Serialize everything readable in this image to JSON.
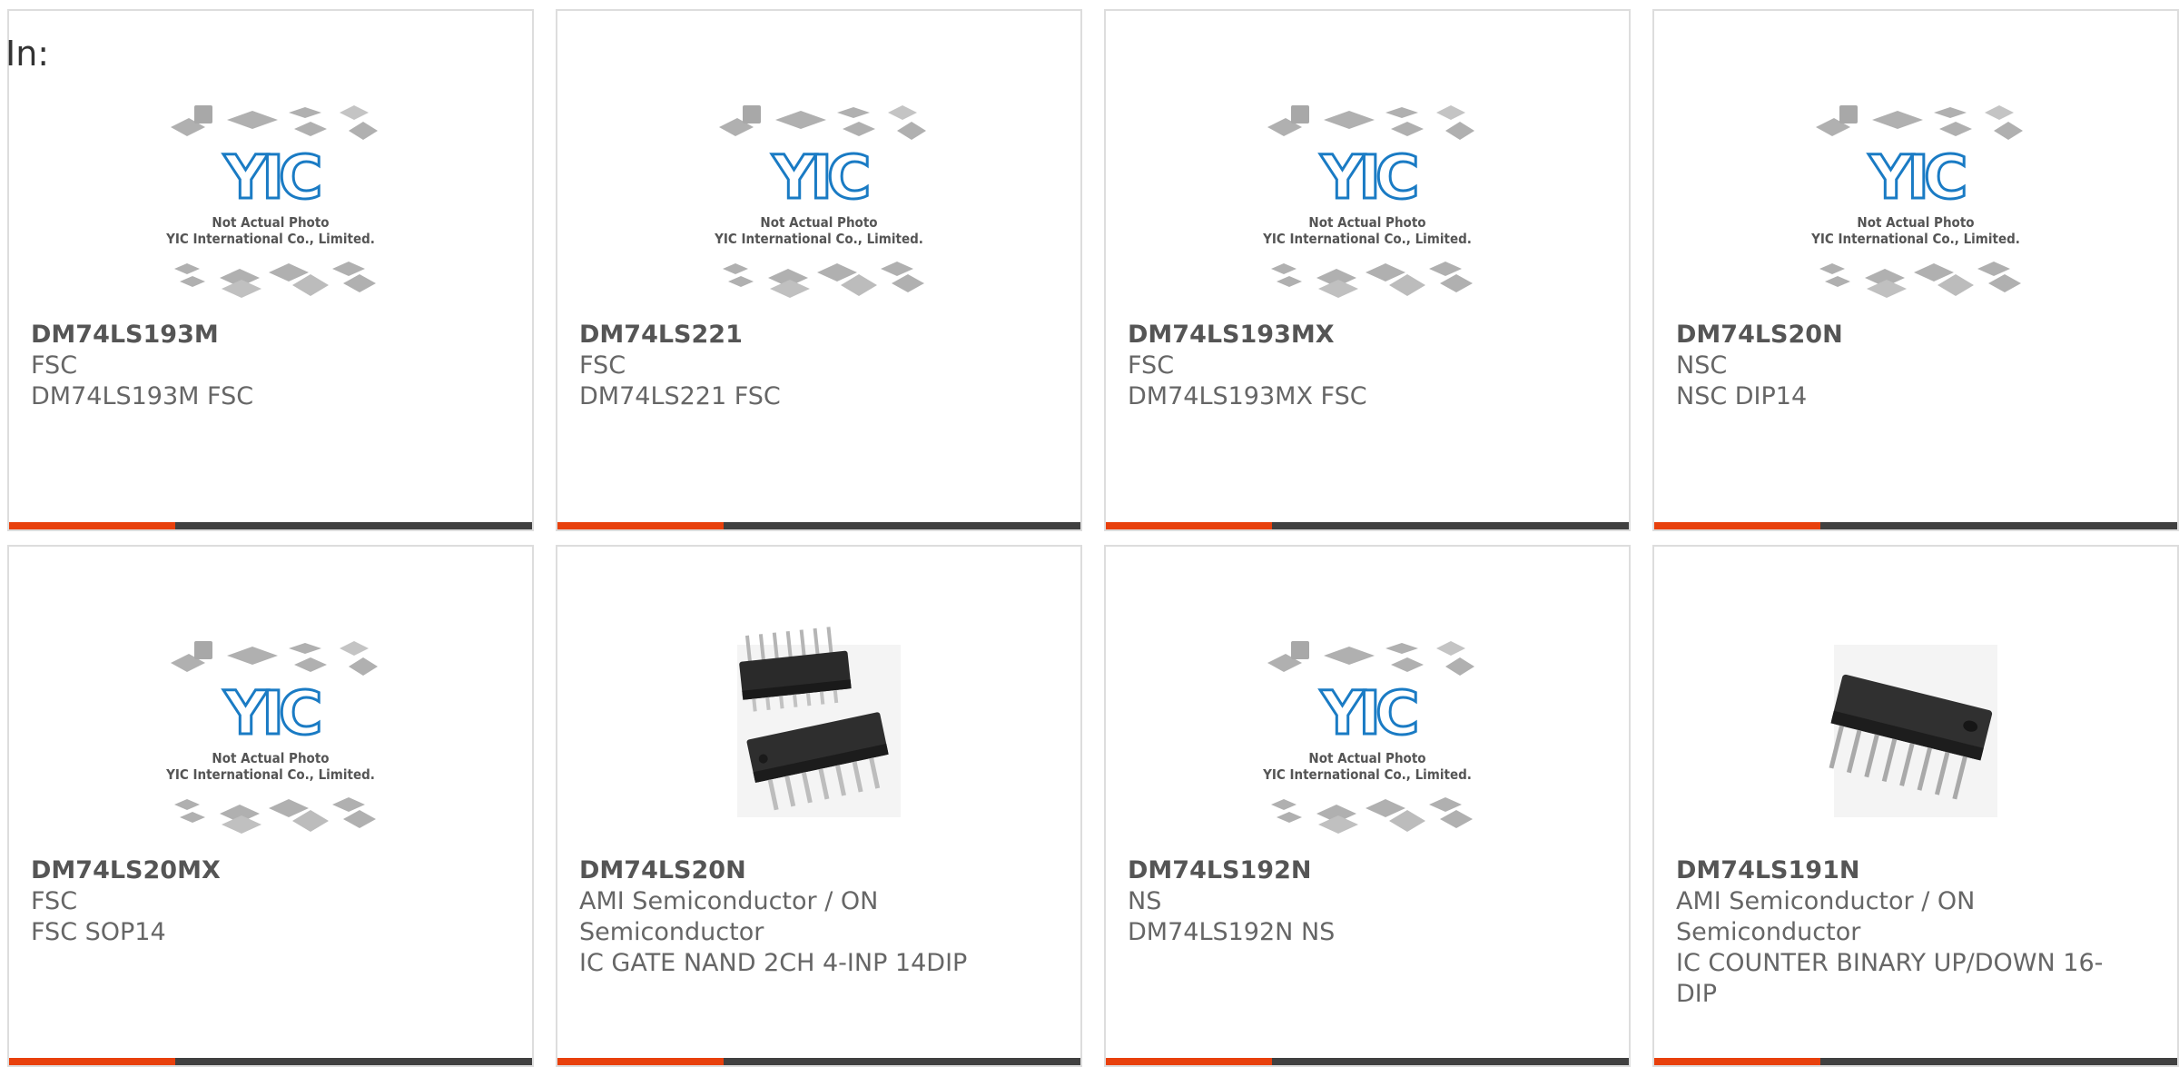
{
  "header": {
    "in_label": "In:"
  },
  "placeholder": {
    "logo_text": "YIC",
    "line1": "Not Actual Photo",
    "line2": "YIC International Co., Limited."
  },
  "colors": {
    "accent": "#e8400c",
    "bar": "#404040",
    "logo": "#1a7bc4"
  },
  "products": [
    {
      "part": "DM74LS193M",
      "maker": "FSC",
      "desc": "DM74LS193M FSC",
      "image": "placeholder"
    },
    {
      "part": "DM74LS221",
      "maker": "FSC",
      "desc": "DM74LS221 FSC",
      "image": "placeholder"
    },
    {
      "part": "DM74LS193MX",
      "maker": "FSC",
      "desc": "DM74LS193MX FSC",
      "image": "placeholder"
    },
    {
      "part": "DM74LS20N",
      "maker": "NSC",
      "desc": "NSC DIP14",
      "image": "placeholder"
    },
    {
      "part": "DM74LS20MX",
      "maker": "FSC",
      "desc": "FSC SOP14",
      "image": "placeholder"
    },
    {
      "part": "DM74LS20N",
      "maker": "AMI Semiconductor / ON Semiconductor",
      "desc": "IC GATE NAND 2CH 4-INP 14DIP",
      "image": "dip14-photo"
    },
    {
      "part": "DM74LS192N",
      "maker": "NS",
      "desc": "DM74LS192N NS",
      "image": "placeholder"
    },
    {
      "part": "DM74LS191N",
      "maker": "AMI Semiconductor / ON Semiconductor",
      "desc": "IC COUNTER BINARY UP/DOWN 16-DIP",
      "image": "dip16-photo"
    }
  ]
}
